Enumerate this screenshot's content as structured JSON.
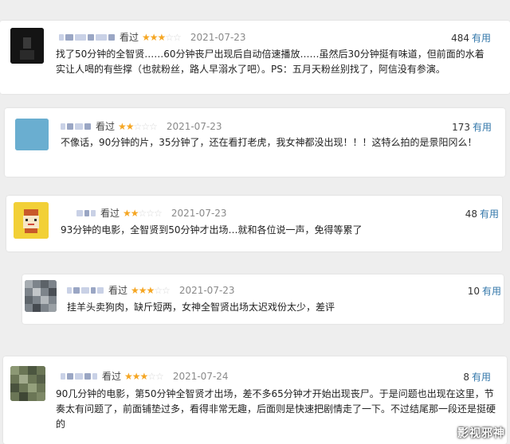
{
  "colors": {
    "star": "#f5a623",
    "link": "#3377aa",
    "date": "#8a8a8a"
  },
  "watermark": "影视邪神",
  "comments": [
    {
      "seen_label": "看过",
      "stars": "★★★",
      "stars_off": "☆☆",
      "rating": 3,
      "date": "2021-07-23",
      "useful_count": "484",
      "useful_label": "有用",
      "text": "找了50分钟的全智贤……60分钟丧尸出现后自动倍速播放……虽然后30分钟挺有味道，但前面的水着实让人喝的有些撑（也就粉丝，路人早溺水了吧）。PS：五月天粉丝别找了，阿信没有参演。",
      "avatar_icon": "dark-portrait-icon"
    },
    {
      "seen_label": "看过",
      "stars": "★★",
      "stars_off": "☆☆☆",
      "rating": 2,
      "date": "2021-07-23",
      "useful_count": "173",
      "useful_label": "有用",
      "text": "不像话，90分钟的片，35分钟了，还在看打老虎，我女神都没出现！！！这特么拍的是景阳冈么！",
      "avatar_icon": "blue-square-icon"
    },
    {
      "seen_label": "看过",
      "stars": "★★",
      "stars_off": "☆☆☆",
      "rating": 2,
      "date": "2021-07-23",
      "useful_count": "48",
      "useful_label": "有用",
      "text": "93分钟的电影，全智贤到50分钟才出场…就和各位说一声，免得等累了",
      "avatar_icon": "cartoon-face-icon"
    },
    {
      "seen_label": "看过",
      "stars": "★★★",
      "stars_off": "☆☆",
      "rating": 3,
      "date": "2021-07-23",
      "useful_count": "10",
      "useful_label": "有用",
      "text": "挂羊头卖狗肉，缺斤短两，女神全智贤出场太迟戏份太少，差评",
      "avatar_icon": "mosaic-photo-icon"
    },
    {
      "seen_label": "看过",
      "stars": "★★★",
      "stars_off": "☆☆",
      "rating": 3,
      "date": "2021-07-24",
      "useful_count": "8",
      "useful_label": "有用",
      "text": "90几分钟的电影，第50分钟全智贤才出场，差不多65分钟才开始出现丧尸。于是问题也出现在这里，节奏太有问题了，前面铺垫过多，看得非常无趣，后面则是快速把剧情走了一下。不过结尾那一段还是挺硬的",
      "avatar_icon": "green-mosaic-icon"
    }
  ]
}
